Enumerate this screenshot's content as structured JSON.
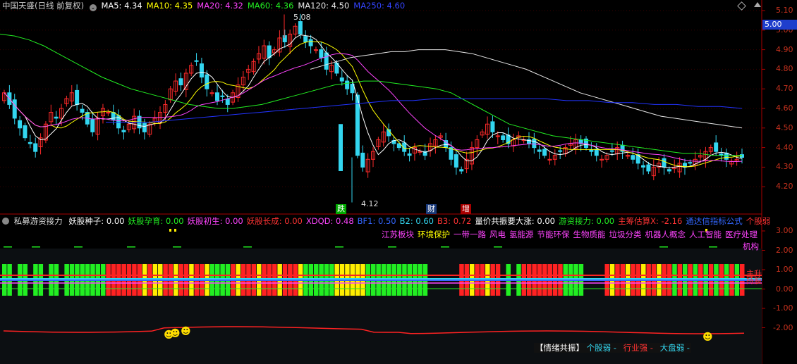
{
  "colors": {
    "bg": "#000000",
    "grid": "#3a0000",
    "separator": "#aa0000",
    "up": "#ff2a2a",
    "down": "#33d6f0",
    "ma5": "#ffffff",
    "ma10": "#ffff00",
    "ma20": "#ff44ff",
    "ma60": "#22ee22",
    "ma120": "#e8e8e8",
    "ma250": "#2233ff",
    "axis_text": "#c8321e"
  },
  "main_header": {
    "stock_name": "中国天盛(日线 前复权)",
    "indicators": [
      {
        "label": "MA5: 4.34",
        "color": "#ffffff"
      },
      {
        "label": "MA10: 4.35",
        "color": "#ffff00"
      },
      {
        "label": "MA20: 4.32",
        "color": "#ff44ff"
      },
      {
        "label": "MA60: 4.36",
        "color": "#22ee22"
      },
      {
        "label": "MA120: 4.50",
        "color": "#e8e8e8"
      },
      {
        "label": "MA250: 4.60",
        "color": "#3344ff"
      }
    ]
  },
  "price_axis": {
    "ticks": [
      "5.10",
      "5.00",
      "4.90",
      "4.80",
      "4.70",
      "4.60",
      "4.50",
      "4.40",
      "4.30",
      "4.20"
    ],
    "current_price_box": "5.00"
  },
  "annotations": {
    "high": "5.08",
    "low": "4.12",
    "markers": [
      {
        "label": "跌",
        "bg": "#00aa00"
      },
      {
        "label": "财",
        "bg": "#1a3a7a"
      },
      {
        "label": "增",
        "bg": "#aa0000"
      }
    ]
  },
  "sub_header": {
    "title": "私募游资接力",
    "items": [
      {
        "label": "妖股种子: 0.00",
        "color": "#ffffff"
      },
      {
        "label": "妖股孕育: 0.00",
        "color": "#22ee22"
      },
      {
        "label": "妖股初生: 0.00",
        "color": "#ff44ff"
      },
      {
        "label": "妖股长成: 0.00",
        "color": "#ff3333"
      },
      {
        "label": "XDQD: 0.48",
        "color": "#ff44ff"
      },
      {
        "label": "BF1: 0.50",
        "color": "#3366ff"
      },
      {
        "label": "B2: 0.60",
        "color": "#33d6f0"
      },
      {
        "label": "B3: 0.72",
        "color": "#ff3333"
      },
      {
        "label": "量价共振要大涨: 0.00",
        "color": "#ffffff"
      },
      {
        "label": "游资接力: 0.00",
        "color": "#22ee22"
      },
      {
        "label": "主筹估算X: -2.16",
        "color": "#ff3333"
      },
      {
        "label": "通达信指标公式",
        "color": "#3366ff"
      },
      {
        "label": "个股弱",
        "color": "#ff3333"
      }
    ],
    "sectors": [
      {
        "label": "江苏板块",
        "color": "#ff44ff"
      },
      {
        "label": "环境保护",
        "color": "#ffff00"
      },
      {
        "label": "一带一路",
        "color": "#ff44ff"
      },
      {
        "label": "风电",
        "color": "#ff44ff"
      },
      {
        "label": "氢能源",
        "color": "#ff44ff"
      },
      {
        "label": "节能环保",
        "color": "#ff44ff"
      },
      {
        "label": "生物质能",
        "color": "#ff44ff"
      },
      {
        "label": "垃圾分类",
        "color": "#ff44ff"
      },
      {
        "label": "机器人概念",
        "color": "#ff44ff"
      },
      {
        "label": "人工智能",
        "color": "#ff44ff"
      },
      {
        "label": "医疗处理",
        "color": "#ff44ff"
      }
    ],
    "sectors_line2": "机构",
    "right_tags": [
      "主升",
      "持股"
    ]
  },
  "sub_axis": {
    "ticks": [
      "3.00",
      "2.00",
      "1.00",
      "0.00",
      "-1.00",
      "-2.00"
    ]
  },
  "bottom_labels": {
    "emotion": "【情绪共振】",
    "stock_weak": "个股弱",
    "industry_strong": "行业强",
    "market_weak": "大盘弱"
  }
}
